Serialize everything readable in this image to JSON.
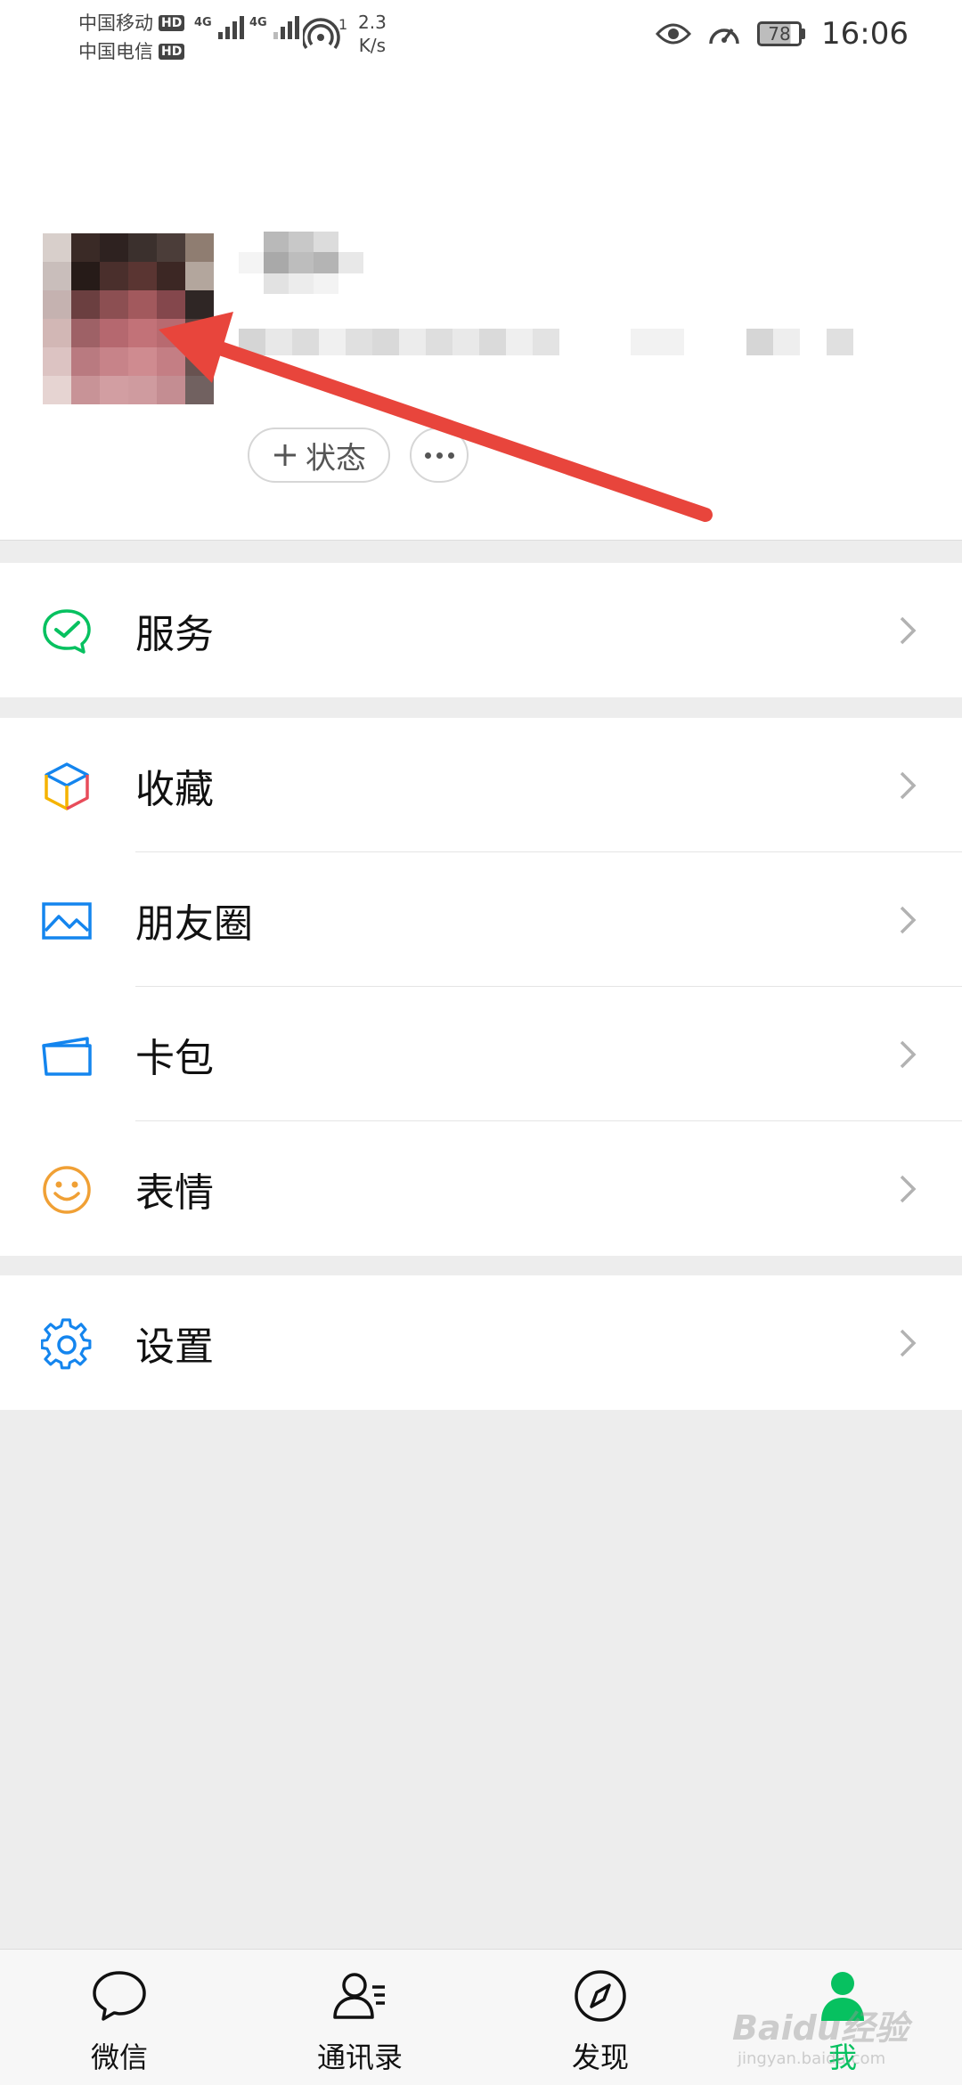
{
  "status_bar": {
    "carrier_1": "中国移动",
    "carrier_2": "中国电信",
    "hd": "HD",
    "network_1": "4G",
    "network_2": "4G",
    "hotspot_count": "1",
    "speed_value": "2.3",
    "speed_unit": "K/s",
    "battery": "78",
    "time": "16:06"
  },
  "profile": {
    "status_button_label": "状态",
    "status_button_icon": "plus-icon",
    "more_button_icon": "ellipsis-icon"
  },
  "menu": {
    "services": {
      "label": "服务",
      "icon": "services-icon"
    },
    "favorites": {
      "label": "收藏",
      "icon": "cube-icon"
    },
    "moments": {
      "label": "朋友圈",
      "icon": "image-icon"
    },
    "card_wallet": {
      "label": "卡包",
      "icon": "card-icon"
    },
    "stickers": {
      "label": "表情",
      "icon": "smiley-icon"
    },
    "settings": {
      "label": "设置",
      "icon": "gear-icon"
    }
  },
  "bottom_nav": {
    "chats": "微信",
    "contacts": "通讯录",
    "discover": "发现",
    "me": "我"
  },
  "watermark": {
    "brand": "Baidu经验",
    "url": "jingyan.baidu.com"
  },
  "colors": {
    "accent_green": "#07c160",
    "annotation_red": "#e8453c",
    "icon_blue": "#1485ee"
  }
}
